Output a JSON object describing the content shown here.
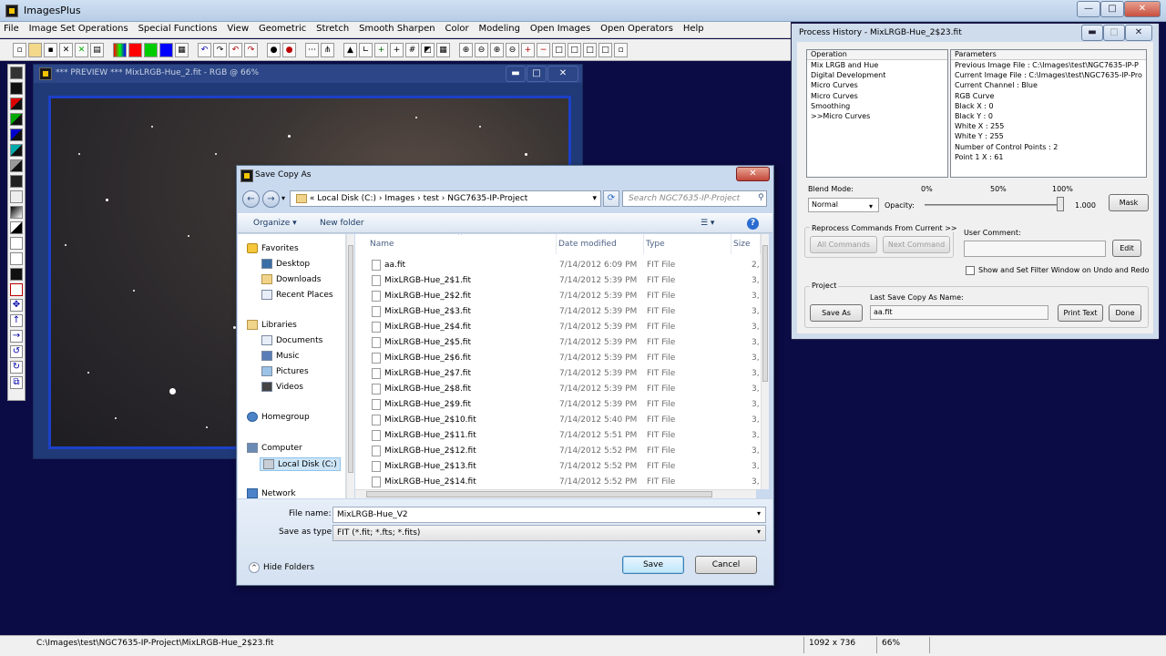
{
  "app": {
    "title": "ImagesPlus",
    "window_buttons": [
      "—",
      "□",
      "✕"
    ]
  },
  "menu": [
    "File",
    "Image Set Operations",
    "Special Functions",
    "View",
    "Geometric",
    "Stretch",
    "Smooth Sharpen",
    "Color",
    "Modeling",
    "Open Images",
    "Open Operators",
    "Help"
  ],
  "preview": {
    "title": "*** PREVIEW *** MixLRGB-Hue_2.fit - RGB @ 66%",
    "buttons": [
      "▬",
      "□",
      "✕"
    ]
  },
  "process_history": {
    "title": "Process History - MixLRGB-Hue_2$23.fit",
    "operation_header": "Operation",
    "parameters_header": "Parameters",
    "operations": [
      "Mix LRGB and Hue",
      "Digital Development",
      "Micro Curves",
      "Micro Curves",
      "Smoothing",
      ">>Micro Curves"
    ],
    "parameters": [
      "Previous Image File : C:\\Images\\test\\NGC7635-IP-P",
      "Current Image File : C:\\Images\\test\\NGC7635-IP-Pro",
      "Current Channel : Blue",
      "RGB Curve",
      " Black X : 0",
      " Black Y : 0",
      " White X : 255",
      " White Y : 255",
      " Number of Control Points : 2",
      "  Point 1 X : 61"
    ],
    "blend_mode_label": "Blend Mode:",
    "blend_mode_value": "Normal",
    "opacity_label": "Opacity:",
    "opacity_ticks": [
      "0%",
      "50%",
      "100%"
    ],
    "opacity_value": "1.000",
    "mask_label": "Mask",
    "reprocess_label": "Reprocess Commands From Current >>",
    "all_commands_label": "All Commands",
    "next_command_label": "Next Command",
    "user_comment_label": "User Comment:",
    "edit_label": "Edit",
    "show_filter_label": "Show and Set Filter Window on Undo and Redo",
    "project_label": "Project",
    "last_save_label": "Last Save Copy As Name:",
    "save_as_label": "Save As",
    "last_save_value": "aa.fit",
    "print_text_label": "Print Text",
    "done_label": "Done"
  },
  "dialog": {
    "title": "Save Copy As",
    "close_label": "✕",
    "path": [
      "«",
      "Local Disk (C:)",
      "›",
      "Images",
      "›",
      "test",
      "›",
      "NGC7635-IP-Project"
    ],
    "search_placeholder": "Search NGC7635-IP-Project",
    "organize_label": "Organize ▾",
    "new_folder_label": "New folder",
    "nav": {
      "favorites": "Favorites",
      "desktop": "Desktop",
      "downloads": "Downloads",
      "recent": "Recent Places",
      "libraries": "Libraries",
      "documents": "Documents",
      "music": "Music",
      "pictures": "Pictures",
      "videos": "Videos",
      "homegroup": "Homegroup",
      "computer": "Computer",
      "local_disk": "Local Disk (C:)",
      "network": "Network"
    },
    "columns": {
      "name": "Name",
      "date": "Date modified",
      "type": "Type",
      "size": "Size"
    },
    "files": [
      {
        "name": "aa.fit",
        "date": "7/14/2012 6:09 PM",
        "type": "FIT File",
        "size": "2,"
      },
      {
        "name": "MixLRGB-Hue_2$1.fit",
        "date": "7/14/2012 5:39 PM",
        "type": "FIT File",
        "size": "3,"
      },
      {
        "name": "MixLRGB-Hue_2$2.fit",
        "date": "7/14/2012 5:39 PM",
        "type": "FIT File",
        "size": "3,"
      },
      {
        "name": "MixLRGB-Hue_2$3.fit",
        "date": "7/14/2012 5:39 PM",
        "type": "FIT File",
        "size": "3,"
      },
      {
        "name": "MixLRGB-Hue_2$4.fit",
        "date": "7/14/2012 5:39 PM",
        "type": "FIT File",
        "size": "3,"
      },
      {
        "name": "MixLRGB-Hue_2$5.fit",
        "date": "7/14/2012 5:39 PM",
        "type": "FIT File",
        "size": "3,"
      },
      {
        "name": "MixLRGB-Hue_2$6.fit",
        "date": "7/14/2012 5:39 PM",
        "type": "FIT File",
        "size": "3,"
      },
      {
        "name": "MixLRGB-Hue_2$7.fit",
        "date": "7/14/2012 5:39 PM",
        "type": "FIT File",
        "size": "3,"
      },
      {
        "name": "MixLRGB-Hue_2$8.fit",
        "date": "7/14/2012 5:39 PM",
        "type": "FIT File",
        "size": "3,"
      },
      {
        "name": "MixLRGB-Hue_2$9.fit",
        "date": "7/14/2012 5:39 PM",
        "type": "FIT File",
        "size": "3,"
      },
      {
        "name": "MixLRGB-Hue_2$10.fit",
        "date": "7/14/2012 5:40 PM",
        "type": "FIT File",
        "size": "3,"
      },
      {
        "name": "MixLRGB-Hue_2$11.fit",
        "date": "7/14/2012 5:51 PM",
        "type": "FIT File",
        "size": "3,"
      },
      {
        "name": "MixLRGB-Hue_2$12.fit",
        "date": "7/14/2012 5:52 PM",
        "type": "FIT File",
        "size": "3,"
      },
      {
        "name": "MixLRGB-Hue_2$13.fit",
        "date": "7/14/2012 5:52 PM",
        "type": "FIT File",
        "size": "3,"
      },
      {
        "name": "MixLRGB-Hue_2$14.fit",
        "date": "7/14/2012 5:52 PM",
        "type": "FIT File",
        "size": "3,"
      }
    ],
    "file_name_label": "File name:",
    "file_name_value": "MixLRGB-Hue_V2",
    "save_type_label": "Save as type:",
    "save_type_value": "FIT (*.fit; *.fts; *.fits)",
    "hide_folders_label": "Hide Folders",
    "save_label": "Save",
    "cancel_label": "Cancel"
  },
  "status": {
    "path": "C:\\Images\\test\\NGC7635-IP-Project\\MixLRGB-Hue_2$23.fit",
    "dimensions": "1092 x 736",
    "zoom": "66%"
  },
  "colors": {
    "workspace": "#0b0b45",
    "preview_border": "#1c40c8",
    "save_button": "#bee6fd"
  }
}
